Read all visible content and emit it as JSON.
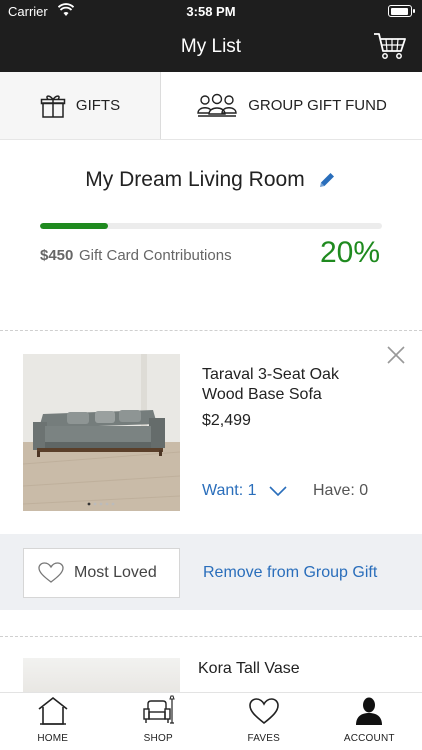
{
  "status_bar": {
    "carrier": "Carrier",
    "time": "3:58 PM"
  },
  "nav": {
    "title": "My List",
    "cart_icon": "cart-icon"
  },
  "tabs": [
    {
      "label": "GIFTS",
      "icon": "gift-icon",
      "active": true
    },
    {
      "label": "GROUP GIFT FUND",
      "icon": "group-icon",
      "active": false
    }
  ],
  "list": {
    "title": "My Dream Living Room",
    "progress_percent": 20,
    "contribution_amount": "$450",
    "contribution_label": "Gift Card Contributions",
    "percent_label": "20%"
  },
  "items": [
    {
      "name": "Taraval 3-Seat Oak Wood Base Sofa",
      "price": "$2,499",
      "want_label": "Want: 1",
      "have_label": "Have: 0"
    },
    {
      "name": "Kora Tall Vase"
    }
  ],
  "actions": {
    "most_loved": "Most Loved",
    "remove": "Remove from Group Gift"
  },
  "bottom_nav": [
    {
      "label": "HOME",
      "icon": "home-icon"
    },
    {
      "label": "SHOP",
      "icon": "sofa-icon"
    },
    {
      "label": "FAVES",
      "icon": "heart-icon"
    },
    {
      "label": "ACCOUNT",
      "icon": "account-icon"
    }
  ],
  "colors": {
    "nav_background": "#1e1e1e",
    "accent_green": "#1f8a1f",
    "link_blue": "#2a6ebb",
    "action_row_bg": "#eef0f3"
  }
}
